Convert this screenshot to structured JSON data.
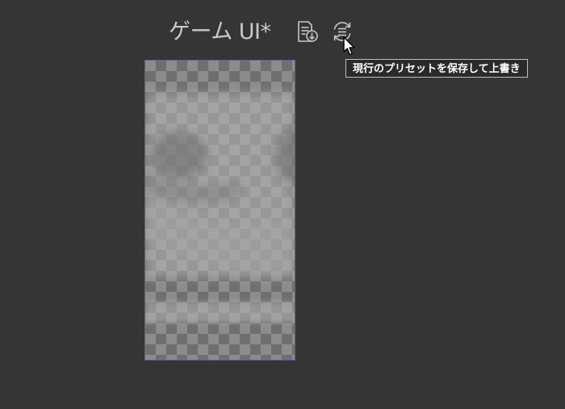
{
  "header": {
    "preset_name": "ゲーム UI*"
  },
  "toolbar": {
    "save_preset_icon": "document-download-icon",
    "overwrite_preset_icon": "list-refresh-icon"
  },
  "tooltip": {
    "text": "現行のプリセットを保存して上書き"
  },
  "preview": {
    "background": "transparency-checkerboard",
    "frame_color": "#5a5ad2"
  },
  "colors": {
    "background": "#353535",
    "title_text": "#c9c9c9",
    "icon": "#c8c8c8",
    "tooltip_bg": "#2a2a2a",
    "tooltip_border": "#bdbdbd"
  }
}
